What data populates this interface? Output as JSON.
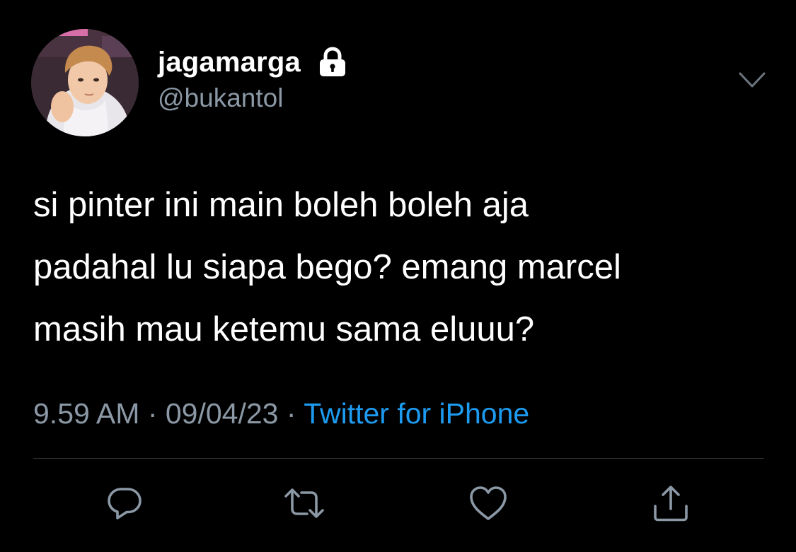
{
  "user": {
    "display_name": "jagamarga",
    "handle": "@bukantol",
    "avatar_icon": "profile-photo",
    "verified_lock_icon": "lock-icon"
  },
  "tweet": {
    "lines": [
      "si pinter ini main boleh boleh aja",
      "padahal lu siapa bego? emang marcel",
      "masih mau ketemu sama eluuu?"
    ]
  },
  "meta": {
    "time": "9.59 AM",
    "separator": " · ",
    "date": "09/04/23",
    "source": "Twitter for iPhone"
  },
  "actions": {
    "reply_icon": "reply-icon",
    "retweet_icon": "retweet-icon",
    "like_icon": "heart-icon",
    "share_icon": "share-icon",
    "more_icon": "chevron-down-icon"
  },
  "colors": {
    "background": "#000000",
    "text": "#ffffff",
    "secondary": "#8b98a5",
    "link": "#1d9bf0",
    "divider": "#2f3336"
  }
}
